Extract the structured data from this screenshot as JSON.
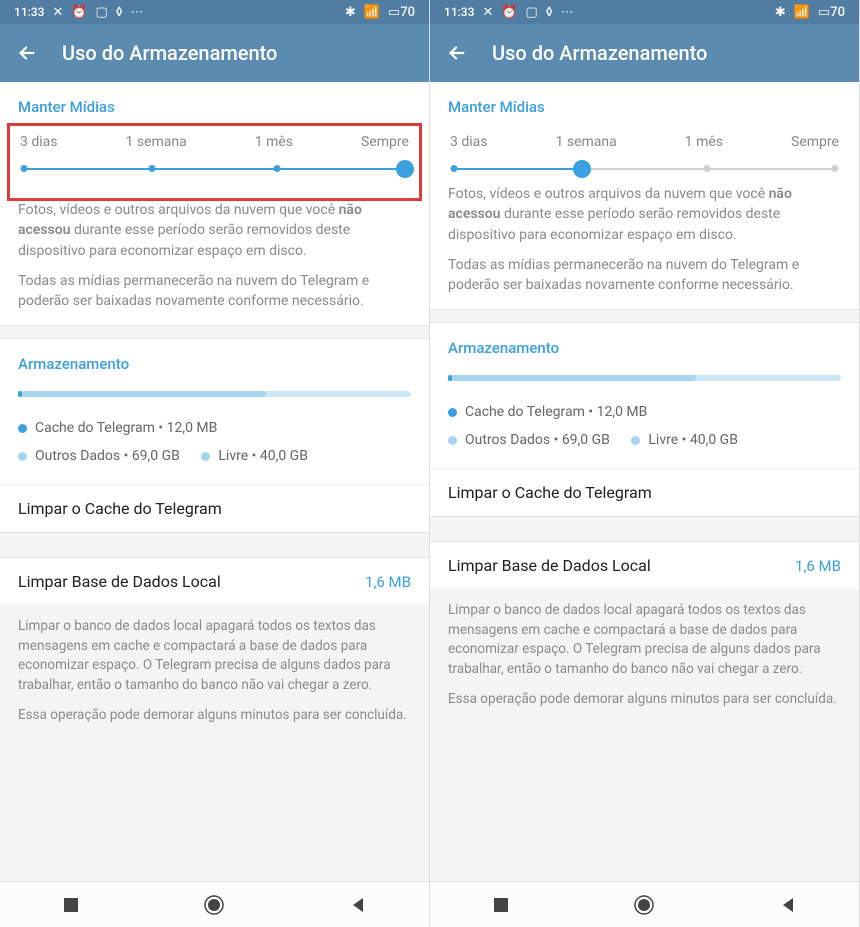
{
  "statusbar": {
    "time": "11:33",
    "battery": "70"
  },
  "header": {
    "title": "Uso do Armazenamento"
  },
  "keep_media": {
    "title": "Manter Mídias",
    "options": [
      "3 dias",
      "1 semana",
      "1 mês",
      "Sempre"
    ],
    "desc1_prefix": "Fotos, vídeos e outros arquivos da nuvem que você ",
    "desc1_bold": "não acessou",
    "desc1_suffix": " durante esse período serão removidos deste dispositivo para economizar espaço em disco.",
    "desc2": "Todas as mídias permanecerão na nuvem do Telegram e poderão ser baixadas novamente conforme necessário."
  },
  "storage": {
    "title": "Armazenamento",
    "cache_label": "Cache do Telegram",
    "cache_size": "12,0 MB",
    "other_label": "Outros Dados",
    "other_size": "69,0 GB",
    "free_label": "Livre",
    "free_size": "40,0 GB",
    "clear_cache": "Limpar o Cache do Telegram"
  },
  "local_db": {
    "action": "Limpar Base de Dados Local",
    "size": "1,6 MB",
    "desc1": "Limpar o banco de dados local apagará todos os textos das mensagens em cache e compactará a base de dados para economizar espaço. O Telegram precisa de alguns dados para trabalhar, então o tamanho do banco não vai chegar a zero.",
    "desc2": "Essa operação pode demorar alguns minutos para ser concluída."
  },
  "panels": [
    {
      "selected_index": 3,
      "highlight": true
    },
    {
      "selected_index": 1,
      "highlight": false
    }
  ],
  "colors": {
    "accent": "#3ba0e0",
    "header": "#5b8bb0"
  }
}
